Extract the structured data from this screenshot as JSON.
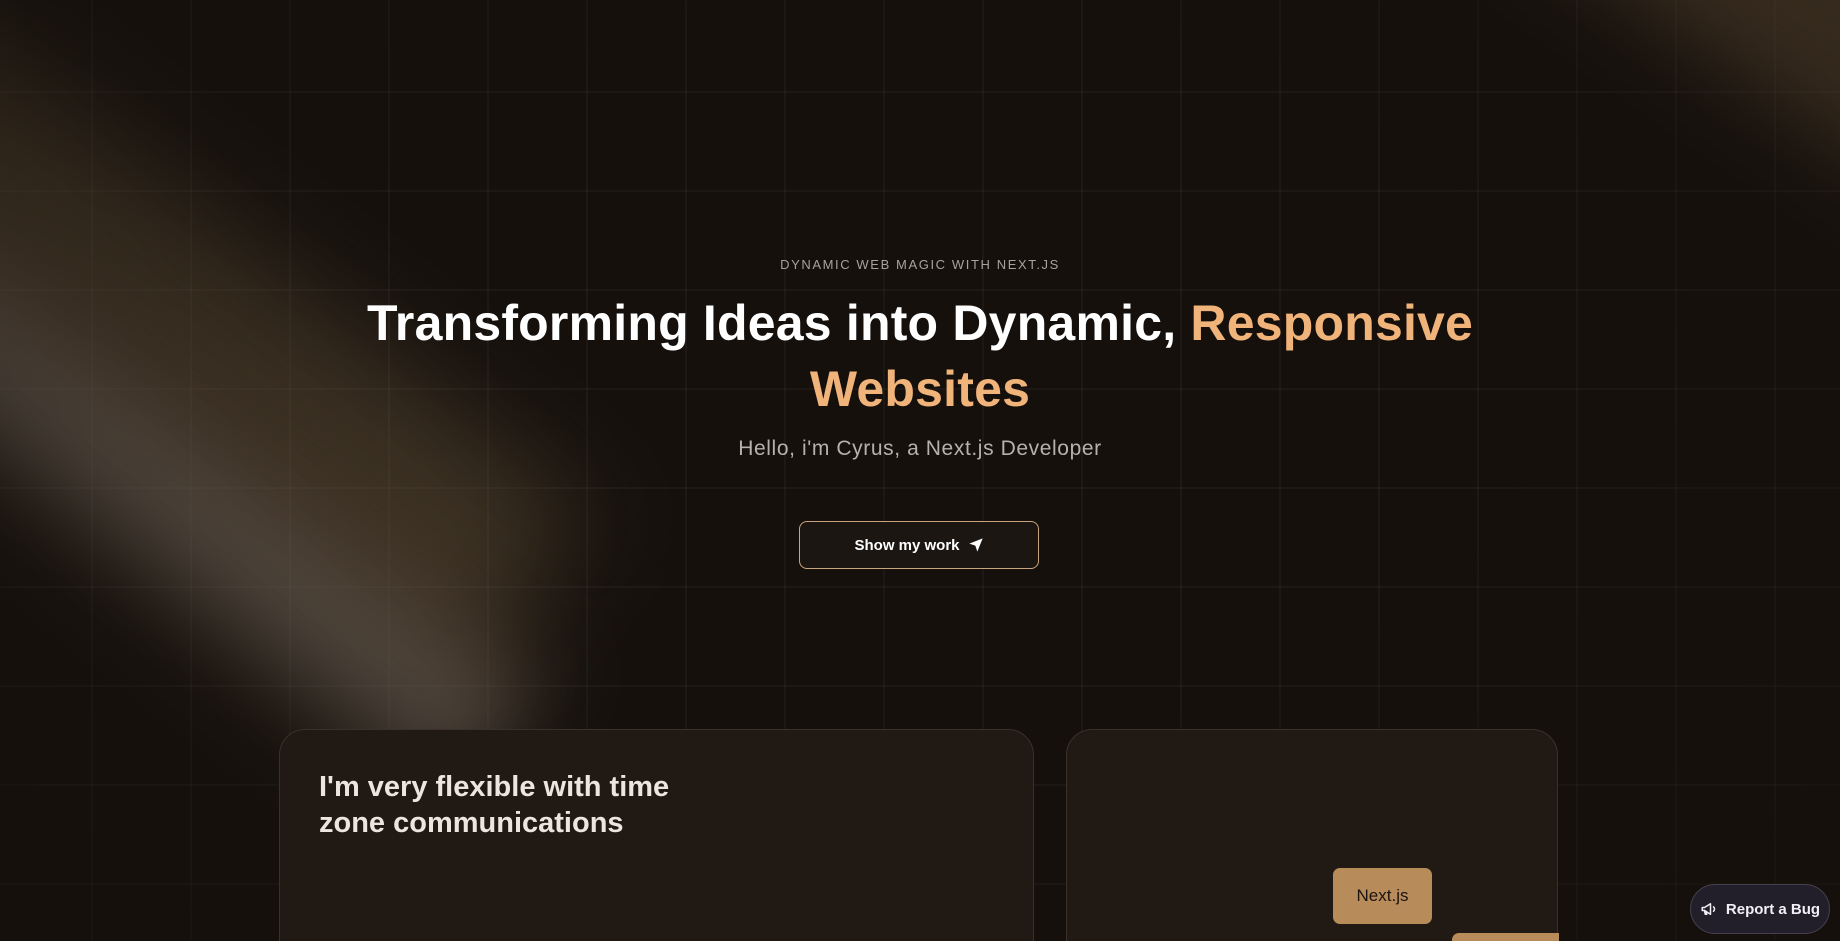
{
  "hero": {
    "eyebrow": "DYNAMIC WEB MAGIC WITH NEXT.JS",
    "headline_main": "Transforming Ideas into Dynamic, ",
    "headline_accent": "Responsive Websites",
    "subtitle": "Hello, i'm Cyrus, a Next.js Developer",
    "cta_label": "Show my work",
    "cta_icon": "send-icon"
  },
  "cards": {
    "left_title": "I'm very flexible with time zone communications",
    "right_chip_label": "Next.js"
  },
  "report_bug": {
    "label": "Report a Bug",
    "icon": "megaphone-icon"
  },
  "colors": {
    "background": "#15100c",
    "accent": "#f0b37a",
    "card_background": "#201914",
    "chip": "#b88b5b"
  }
}
